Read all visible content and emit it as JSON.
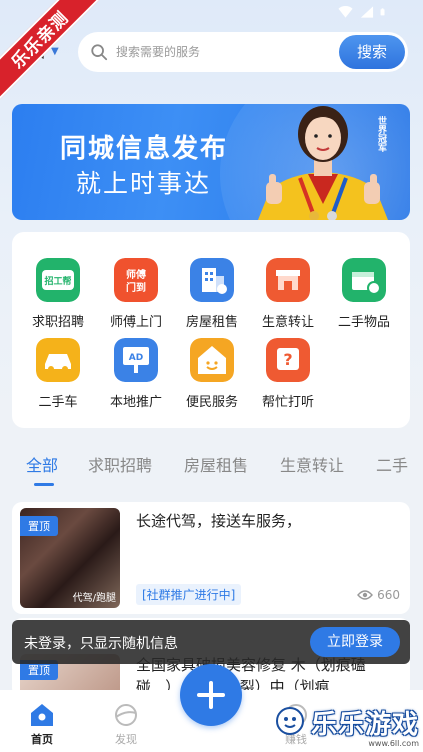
{
  "status_bar": {
    "icons": [
      "wifi-icon",
      "signal-icon",
      "battery-icon"
    ]
  },
  "ribbon": {
    "text": "乐乐亲测"
  },
  "header": {
    "city": "国",
    "search_placeholder": "搜索需要的服务",
    "search_button": "搜索"
  },
  "banner": {
    "title": "同城信息发布",
    "subtitle": "就上时事达",
    "side_tag": "世界冠军"
  },
  "categories": [
    {
      "label": "求职招聘",
      "icon": "招工帮",
      "icon_name": "job-board-icon",
      "color": "#22b36b"
    },
    {
      "label": "师傅上门",
      "icon": "师傅门到",
      "icon_name": "master-service-icon",
      "color": "#f0522e"
    },
    {
      "label": "房屋租售",
      "icon": "",
      "icon_name": "building-icon",
      "color": "#3b82e6"
    },
    {
      "label": "生意转让",
      "icon": "",
      "icon_name": "shop-icon",
      "color": "#ef5a32"
    },
    {
      "label": "二手物品",
      "icon": "",
      "icon_name": "box-icon",
      "color": "#22b36b"
    },
    {
      "label": "二手车",
      "icon": "",
      "icon_name": "car-icon",
      "color": "#f5b21a"
    },
    {
      "label": "本地推广",
      "icon": "AD",
      "icon_name": "ad-icon",
      "color": "#3b82e6"
    },
    {
      "label": "便民服务",
      "icon": "",
      "icon_name": "smiley-house-icon",
      "color": "#f5a623"
    },
    {
      "label": "帮忙打听",
      "icon": "",
      "icon_name": "question-icon",
      "color": "#ef5a32"
    }
  ],
  "tabs": [
    "全部",
    "求职招聘",
    "房屋租售",
    "生意转让",
    "二手"
  ],
  "posts": [
    {
      "pinned": "置顶",
      "title": "长途代驾，接送车服务，",
      "thumb_caption": "代驾/跑腿",
      "tag": "[社群推广进行中]",
      "views": "660"
    },
    {
      "pinned": "置顶",
      "title": "全国家具破损美容修复 木（划痕磕碰...）...老化开裂）中（划痕"
    }
  ],
  "toast": {
    "text": "未登录，只显示随机信息",
    "button": "立即登录"
  },
  "bottom_nav": {
    "home": "首页",
    "discover": "发现",
    "earn": "赚钱"
  },
  "watermark": {
    "main": "乐乐游戏",
    "url": "www.6ll.com"
  }
}
